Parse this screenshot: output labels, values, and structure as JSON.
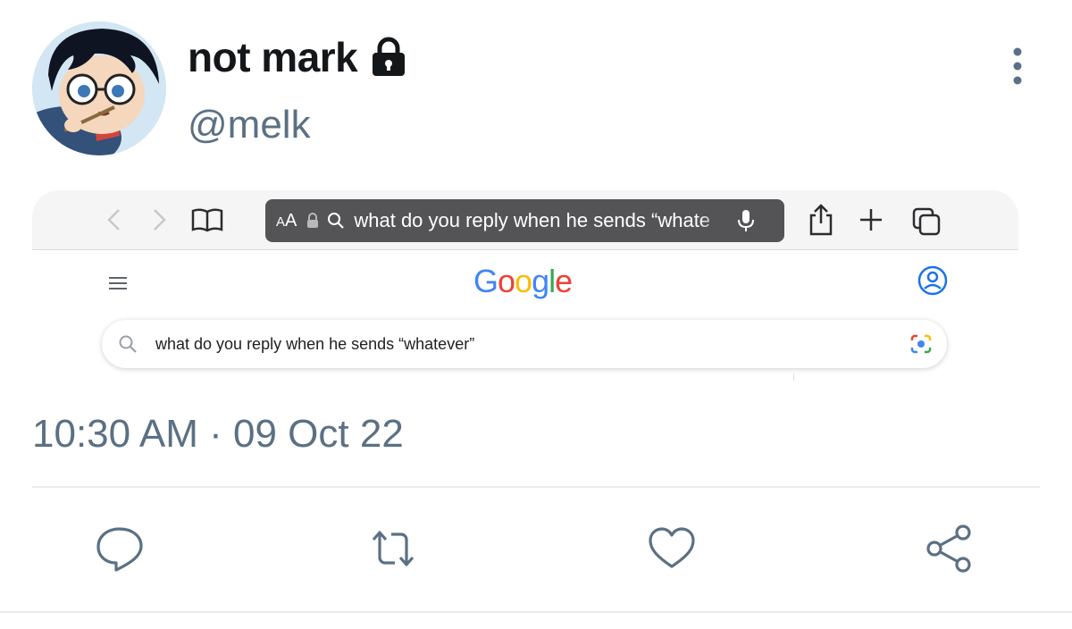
{
  "tweet": {
    "display_name": "not mark",
    "handle": "@melk",
    "timestamp": "10:30 AM · 09 Oct 22"
  },
  "embedded_screenshot": {
    "browser": {
      "text_size_label_small": "A",
      "text_size_label_large": "A",
      "address_text": "what do you reply when he sends “whate"
    },
    "google": {
      "logo_letters": [
        "G",
        "o",
        "o",
        "g",
        "l",
        "e"
      ],
      "logo_colors": [
        "#4285F4",
        "#EA4335",
        "#FBBC05",
        "#4285F4",
        "#34A853",
        "#EA4335"
      ],
      "search_query": "what do you reply when he sends “whatever”"
    }
  },
  "icons": {
    "header": [
      "avatar",
      "lock-icon",
      "more-options-icon"
    ],
    "browser": [
      "back-icon",
      "forward-icon",
      "bookmarks-icon",
      "lock-icon",
      "search-icon",
      "microphone-icon",
      "share-icon",
      "plus-icon",
      "tabs-icon"
    ],
    "google": [
      "hamburger-menu-icon",
      "account-icon",
      "search-icon",
      "camera-lens-icon"
    ],
    "actions": [
      "reply-icon",
      "retweet-icon",
      "like-icon",
      "share-icon"
    ]
  },
  "colors": {
    "text_primary": "#14171a",
    "text_secondary": "#5b7083",
    "icon_gray": "#5b7083",
    "address_bar": "#545456"
  }
}
